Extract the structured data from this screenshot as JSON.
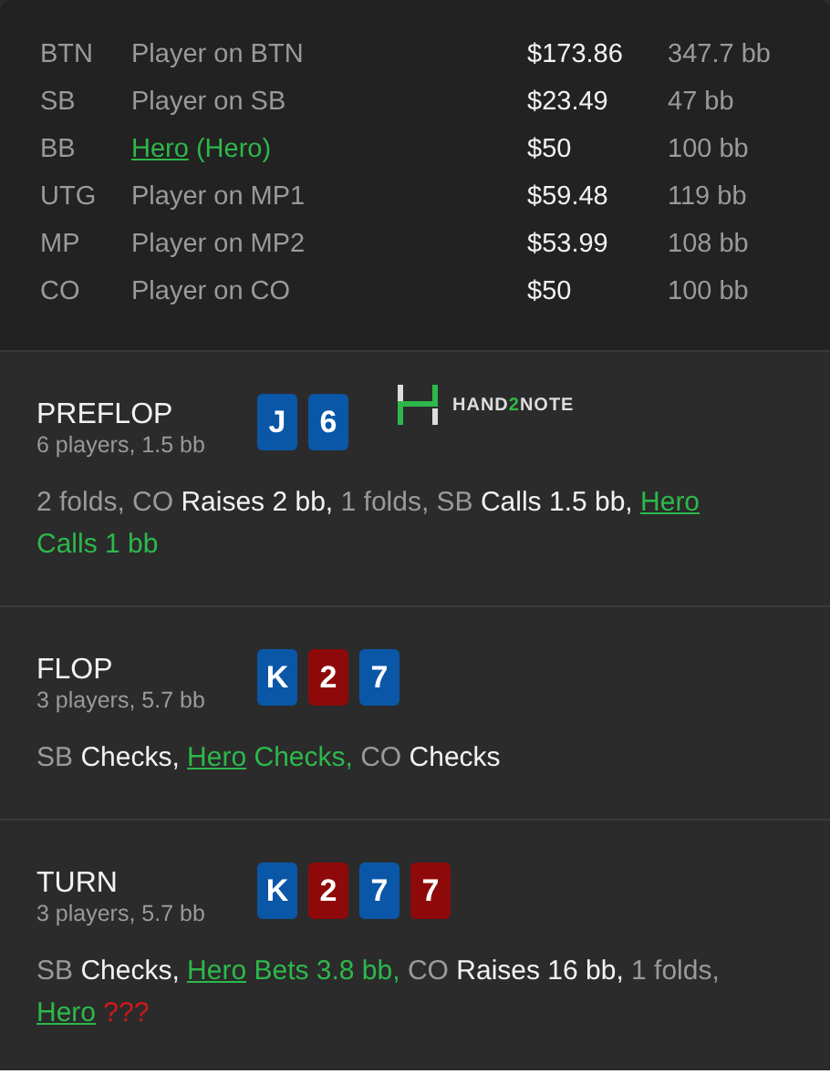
{
  "players": [
    {
      "position": "BTN",
      "name": "Player on BTN",
      "hero": false,
      "stack": "$173.86",
      "bb": "347.7 bb"
    },
    {
      "position": "SB",
      "name": "Player on SB",
      "hero": false,
      "stack": "$23.49",
      "bb": "47 bb"
    },
    {
      "position": "BB",
      "name": "Hero",
      "alias": "(Hero)",
      "hero": true,
      "stack": "$50",
      "bb": "100 bb"
    },
    {
      "position": "UTG",
      "name": "Player on MP1",
      "hero": false,
      "stack": "$59.48",
      "bb": "119 bb"
    },
    {
      "position": "MP",
      "name": "Player on MP2",
      "hero": false,
      "stack": "$53.99",
      "bb": "108 bb"
    },
    {
      "position": "CO",
      "name": "Player on CO",
      "hero": false,
      "stack": "$50",
      "bb": "100 bb"
    }
  ],
  "streets": [
    {
      "title": "PREFLOP",
      "subtitle": "6 players, 1.5 bb",
      "cards": [
        {
          "rank": "J",
          "color": "#0a57a8"
        },
        {
          "rank": "6",
          "color": "#0a57a8"
        }
      ],
      "logo": {
        "parts": [
          {
            "text": "HAND",
            "kind": "plain"
          },
          {
            "text": "2",
            "kind": "accent"
          },
          {
            "text": "NOTE",
            "kind": "plain"
          }
        ]
      },
      "actions": [
        {
          "text": "2 folds, CO ",
          "kind": "actor"
        },
        {
          "text": "Raises 2 bb,",
          "kind": "action"
        },
        {
          "text": " 1 folds, SB ",
          "kind": "actor"
        },
        {
          "text": "Calls 1.5 bb, ",
          "kind": "action"
        },
        {
          "text": "Hero",
          "kind": "hero-link"
        },
        {
          "text": " Calls 1 bb",
          "kind": "hero"
        }
      ]
    },
    {
      "title": "FLOP",
      "subtitle": "3 players, 5.7 bb",
      "cards": [
        {
          "rank": "K",
          "color": "#0a57a8"
        },
        {
          "rank": "2",
          "color": "#8e0a0a"
        },
        {
          "rank": "7",
          "color": "#0a57a8"
        }
      ],
      "actions": [
        {
          "text": "SB ",
          "kind": "actor"
        },
        {
          "text": "Checks, ",
          "kind": "action"
        },
        {
          "text": "Hero",
          "kind": "hero-link"
        },
        {
          "text": " Checks,",
          "kind": "hero"
        },
        {
          "text": " CO ",
          "kind": "actor"
        },
        {
          "text": "Checks",
          "kind": "action"
        }
      ]
    },
    {
      "title": "TURN",
      "subtitle": "3 players, 5.7 bb",
      "cards": [
        {
          "rank": "K",
          "color": "#0a57a8"
        },
        {
          "rank": "2",
          "color": "#8e0a0a"
        },
        {
          "rank": "7",
          "color": "#0a57a8"
        },
        {
          "rank": "7",
          "color": "#8e0a0a"
        }
      ],
      "actions": [
        {
          "text": "SB ",
          "kind": "actor"
        },
        {
          "text": "Checks, ",
          "kind": "action"
        },
        {
          "text": "Hero",
          "kind": "hero-link"
        },
        {
          "text": " Bets 3.8 bb,",
          "kind": "hero"
        },
        {
          "text": " CO ",
          "kind": "actor"
        },
        {
          "text": "Raises 16 bb,",
          "kind": "action"
        },
        {
          "text": " 1 folds, ",
          "kind": "actor"
        },
        {
          "text": "Hero",
          "kind": "hero-link"
        },
        {
          "text": " ???",
          "kind": "unknown"
        }
      ]
    }
  ]
}
